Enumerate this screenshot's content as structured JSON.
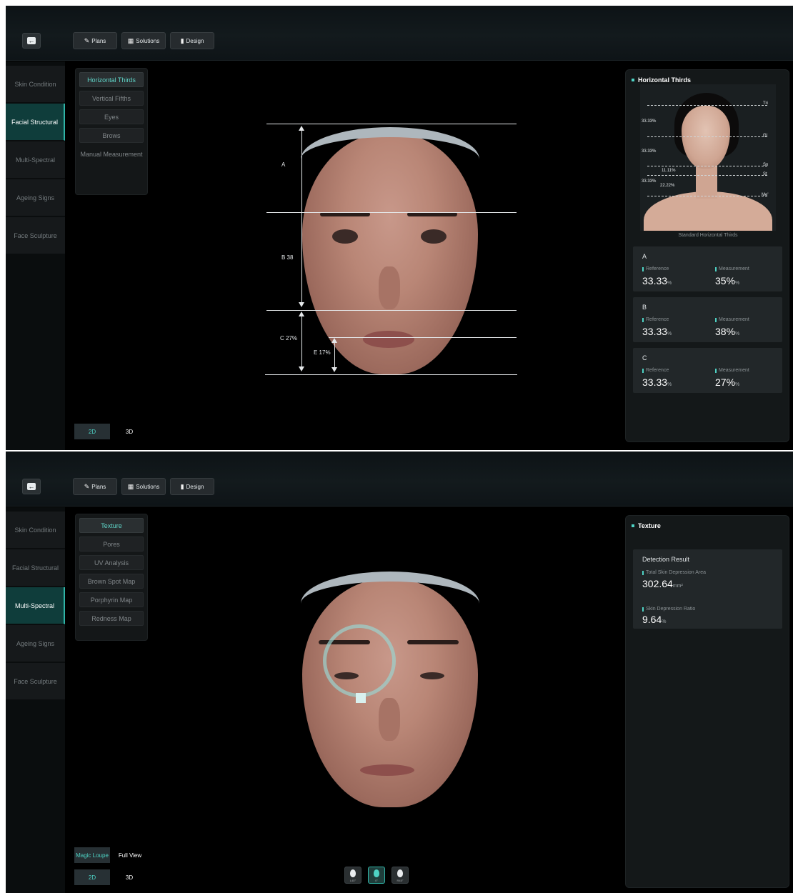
{
  "screens": [
    {
      "toolbar": {
        "back_icon": "arrow-left-icon",
        "tabs": [
          "Plans",
          "Solutions",
          "Design"
        ]
      },
      "sidebar": {
        "items": [
          "Skin Condition",
          "Facial Structural",
          "Multi-Spectral",
          "Ageing Signs",
          "Face Sculpture"
        ],
        "active": "Facial Structural"
      },
      "submenu": {
        "items": [
          "Horizontal Thirds",
          "Vertical Fifths",
          "Eyes",
          "Brows",
          "Manual Measurement"
        ],
        "active": "Horizontal Thirds"
      },
      "view_modes": [
        "2D",
        "3D"
      ],
      "view_mode_active": "2D",
      "face_overlay": {
        "label_a": "A",
        "label_b": "B 38",
        "label_c": "C 27%",
        "label_e": "E 17%"
      },
      "panel": {
        "title": "Horizontal Thirds",
        "reference_image": {
          "caption": "Standard Horizontal Thirds",
          "landmarks": [
            "Tri",
            "Gl",
            "Sn",
            "St",
            "Me'"
          ],
          "percents": [
            "33.33%",
            "33.33%",
            "11.11%",
            "33.33%",
            "22.22%"
          ]
        },
        "cards": [
          {
            "name": "A",
            "reference_label": "Reference",
            "reference_value": "33.33",
            "reference_unit": "%",
            "measurement_label": "Measurement",
            "measurement_value": "35%",
            "measurement_unit": "%"
          },
          {
            "name": "B",
            "reference_label": "Reference",
            "reference_value": "33.33",
            "reference_unit": "%",
            "measurement_label": "Measurement",
            "measurement_value": "38%",
            "measurement_unit": "%"
          },
          {
            "name": "C",
            "reference_label": "Reference",
            "reference_value": "33.33",
            "reference_unit": "%",
            "measurement_label": "Measurement",
            "measurement_value": "27%",
            "measurement_unit": "%"
          }
        ]
      }
    },
    {
      "toolbar": {
        "back_icon": "arrow-left-icon",
        "tabs": [
          "Plans",
          "Solutions",
          "Design"
        ]
      },
      "sidebar": {
        "items": [
          "Skin Condition",
          "Facial Structural",
          "Multi-Spectral",
          "Ageing Signs",
          "Face Sculpture"
        ],
        "active": "Multi-Spectral"
      },
      "submenu": {
        "items": [
          "Texture",
          "Pores",
          "UV Analysis",
          "Brown Spot Map",
          "Porphyrin Map",
          "Redness Map"
        ],
        "active": "Texture"
      },
      "loupe_modes": [
        "Magic Loupe",
        "Full View"
      ],
      "loupe_mode_active": "Magic Loupe",
      "view_modes": [
        "2D",
        "3D"
      ],
      "view_mode_active": "2D",
      "angle_buttons": [
        {
          "label": "L45°",
          "icon": "head-left-icon"
        },
        {
          "label": "0°",
          "icon": "head-front-icon"
        },
        {
          "label": "R45°",
          "icon": "head-right-icon"
        }
      ],
      "angle_active": "0°",
      "panel": {
        "title": "Texture",
        "card_title": "Detection Result",
        "metrics": [
          {
            "label": "Total Skin Depression Area",
            "value": "302.64",
            "unit": "mm²"
          },
          {
            "label": "Skin Depression Ratio",
            "value": "9.64",
            "unit": "%"
          }
        ]
      }
    }
  ],
  "colors": {
    "accent": "#4ed2c4",
    "active_nav": "#0f3d3b",
    "background": "#000000",
    "panel": "#141819"
  }
}
